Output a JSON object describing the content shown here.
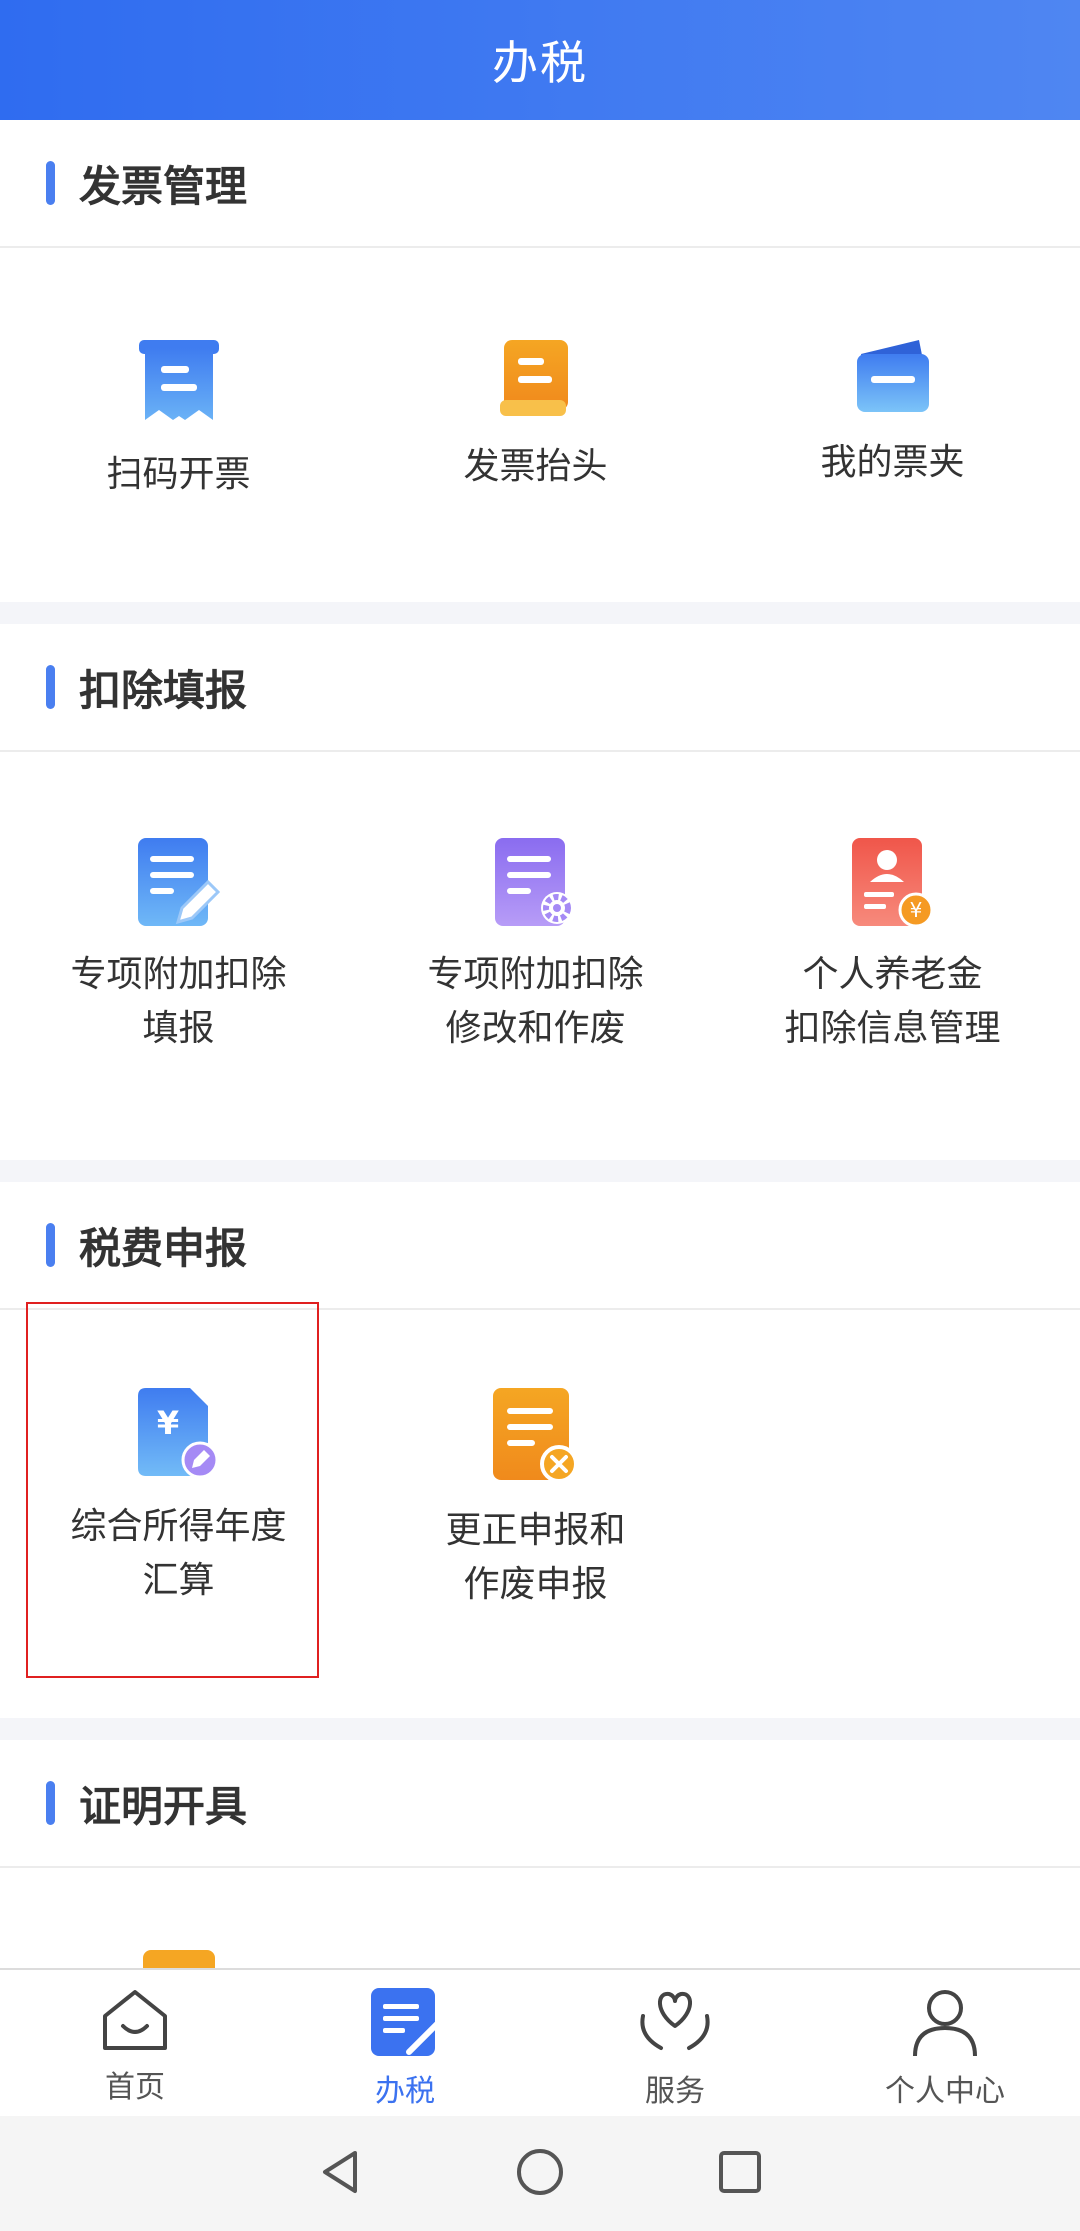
{
  "header": {
    "title": "办税"
  },
  "sections": [
    {
      "title": "发票管理",
      "items": [
        {
          "label": "扫码开票",
          "icon": "receipt-icon"
        },
        {
          "label": "发票抬头",
          "icon": "invoice-header-icon"
        },
        {
          "label": "我的票夹",
          "icon": "wallet-icon"
        }
      ]
    },
    {
      "title": "扣除填报",
      "items": [
        {
          "line1": "专项附加扣除",
          "line2": "填报",
          "icon": "document-edit-icon"
        },
        {
          "line1": "专项附加扣除",
          "line2": "修改和作废",
          "icon": "document-settings-icon"
        },
        {
          "line1": "个人养老金",
          "line2": "扣除信息管理",
          "icon": "pension-card-icon"
        }
      ]
    },
    {
      "title": "税费申报",
      "items": [
        {
          "line1": "综合所得年度",
          "line2": "汇算",
          "icon": "yuan-document-edit-icon"
        },
        {
          "line1": "更正申报和",
          "line2": "作废申报",
          "icon": "document-cancel-icon"
        }
      ]
    },
    {
      "title": "证明开具",
      "items": []
    }
  ],
  "tabbar": [
    {
      "label": "首页",
      "icon": "home-icon",
      "active": false
    },
    {
      "label": "办税",
      "icon": "tax-document-icon",
      "active": true
    },
    {
      "label": "服务",
      "icon": "heart-hands-icon",
      "active": false
    },
    {
      "label": "个人中心",
      "icon": "user-icon",
      "active": false
    }
  ],
  "colors": {
    "header_gradient_start": "#2f6cf0",
    "header_gradient_end": "#4f86f2",
    "accent": "#3b72f0",
    "highlight_border": "#e02020"
  }
}
